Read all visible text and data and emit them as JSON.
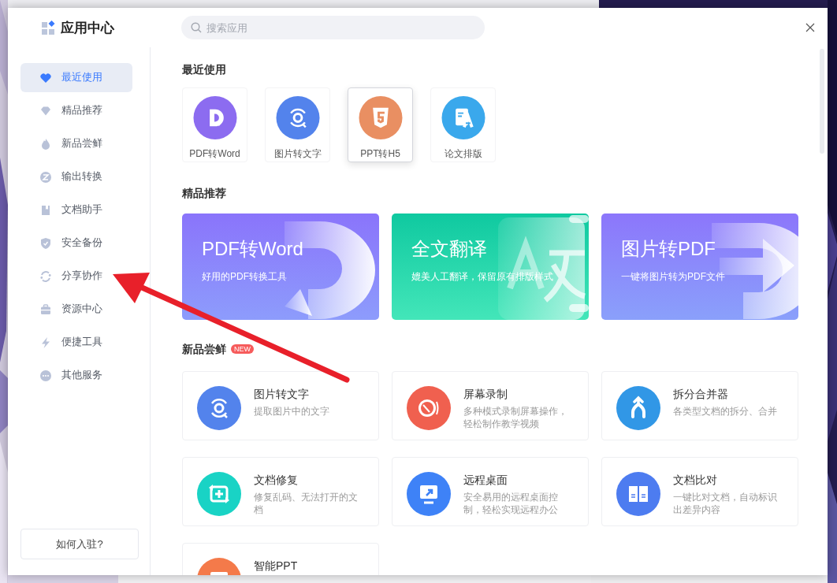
{
  "window": {
    "title": "应用中心"
  },
  "search": {
    "placeholder": "搜索应用"
  },
  "sidebar": {
    "items": [
      {
        "label": "最近使用",
        "kind": "heart",
        "selected": true
      },
      {
        "label": "精品推荐",
        "kind": "gem",
        "selected": false
      },
      {
        "label": "新品尝鲜",
        "kind": "flame",
        "selected": false
      },
      {
        "label": "输出转换",
        "kind": "swap",
        "selected": false
      },
      {
        "label": "文档助手",
        "kind": "bookmark",
        "selected": false
      },
      {
        "label": "安全备份",
        "kind": "shield",
        "selected": false
      },
      {
        "label": "分享协作",
        "kind": "sync",
        "selected": false
      },
      {
        "label": "资源中心",
        "kind": "briefcase",
        "selected": false
      },
      {
        "label": "便捷工具",
        "kind": "bolt",
        "selected": false
      },
      {
        "label": "其他服务",
        "kind": "more",
        "selected": false
      }
    ],
    "footer_button": "如何入驻?"
  },
  "recent": {
    "title": "最近使用",
    "apps": [
      {
        "label": "PDF转Word",
        "kind": "pdf",
        "color": "#8c6cf0",
        "selected": false
      },
      {
        "label": "图片转文字",
        "kind": "scan",
        "color": "#5383ec",
        "selected": false
      },
      {
        "label": "PPT转H5",
        "kind": "html",
        "color": "#e98f62",
        "selected": true
      },
      {
        "label": "论文排版",
        "kind": "layout",
        "color": "#3aa8ec",
        "selected": false
      }
    ]
  },
  "featured": {
    "title": "精品推荐",
    "banners": [
      {
        "title": "PDF转Word",
        "subtitle": "好用的PDF转换工具",
        "kind": "pdf"
      },
      {
        "title": "全文翻译",
        "subtitle": "媲美人工翻译，保留原有排版样式",
        "kind": "translate"
      },
      {
        "title": "图片转PDF",
        "subtitle": "一键将图片转为PDF文件"
      }
    ]
  },
  "new_apps": {
    "title": "新品尝鲜",
    "badge": "NEW",
    "apps": [
      {
        "title": "图片转文字",
        "description": "提取图片中的文字",
        "kind": "scan",
        "color": "#5383ec"
      },
      {
        "title": "屏幕录制",
        "description": "多种模式录制屏幕操作，轻松制作教学视频",
        "kind": "record",
        "color": "#f0604f"
      },
      {
        "title": "拆分合并器",
        "description": "各类型文档的拆分、合并",
        "kind": "merge",
        "color": "#3197e6"
      },
      {
        "title": "文档修复",
        "description": "修复乱码、无法打开的文档",
        "kind": "repair",
        "color": "#19d3c5"
      },
      {
        "title": "远程桌面",
        "description": "安全易用的远程桌面控制，轻松实现远程办公",
        "kind": "remote",
        "color": "#3e82f7"
      },
      {
        "title": "文档比对",
        "description": "一键比对文档，自动标识出差异内容",
        "kind": "compare",
        "color": "#4d7cf0"
      },
      {
        "title": "智能PPT",
        "kind": "ppt",
        "color": "#f47a4a"
      }
    ]
  }
}
